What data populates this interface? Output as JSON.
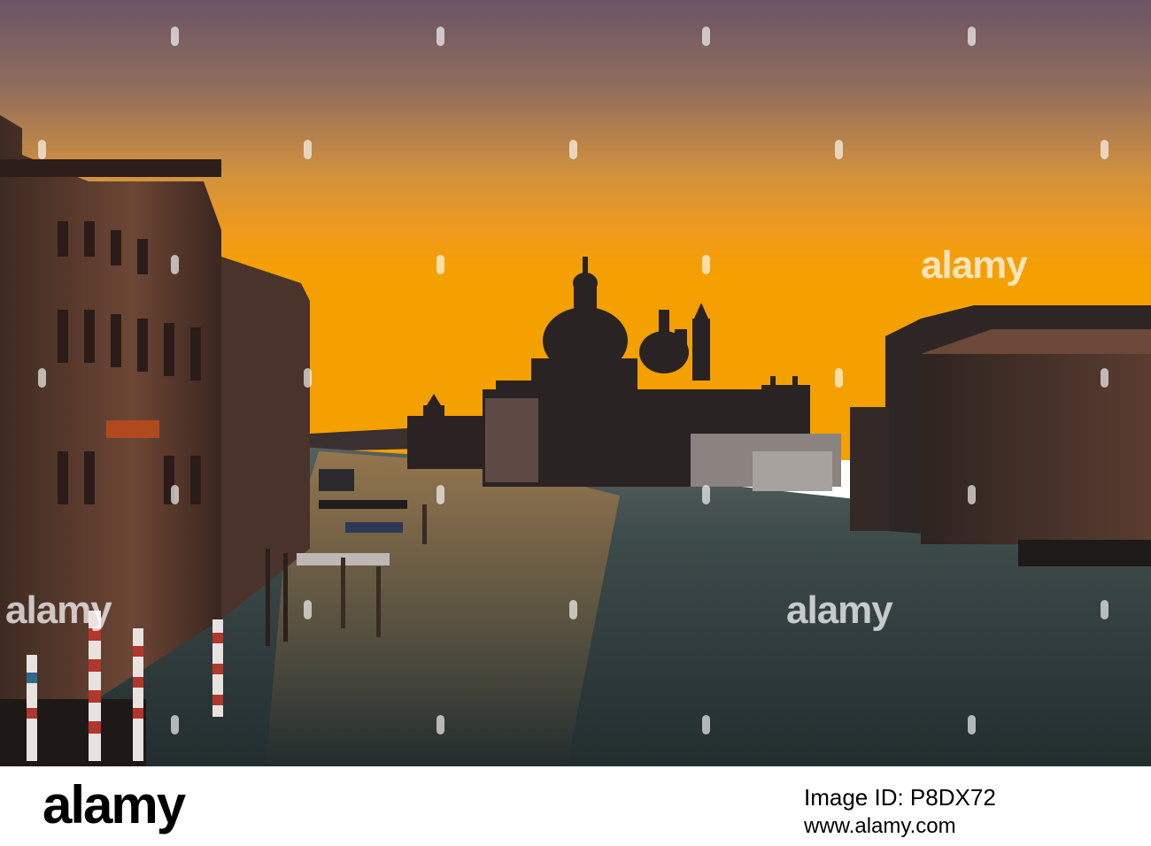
{
  "photo": {
    "scene": "Grand Canal, Venice at sunrise with domed basilica silhouette",
    "colors": {
      "sky_top": "#6b5666",
      "sky_mid": "#e59a35",
      "sky_horizon": "#f2a000",
      "water": "#2c3a3a",
      "buildings_dark": "#1c1614",
      "buildings_lit": "#6e4a36"
    }
  },
  "watermarks": {
    "text": "alamy"
  },
  "footer": {
    "logo": "alamy",
    "image_id_label": "Image ID: P8DX72",
    "url": "www.alamy.com"
  }
}
